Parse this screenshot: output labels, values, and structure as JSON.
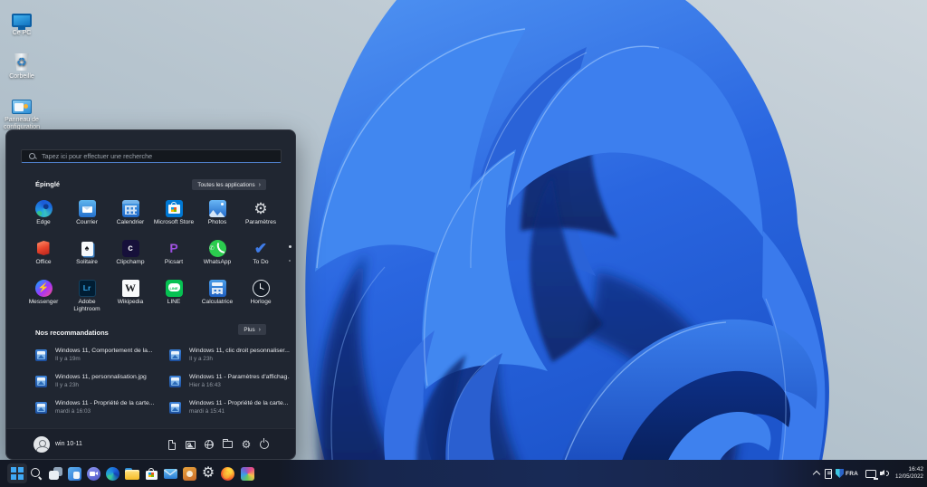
{
  "desktop": {
    "icons": [
      {
        "label": "Ce PC",
        "icon": "this-pc-icon"
      },
      {
        "label": "Corbeille",
        "icon": "recycle-bin-icon"
      },
      {
        "label": "Panneau de configuration",
        "icon": "control-panel-icon"
      }
    ]
  },
  "start_menu": {
    "search_placeholder": "Tapez ici pour effectuer une recherche",
    "pinned_header": "Épinglé",
    "all_apps_label": "Toutes les applications",
    "chevron": "›",
    "pinned_apps": [
      {
        "label": "Edge",
        "icon": "edge-icon"
      },
      {
        "label": "Courrier",
        "icon": "mail-icon"
      },
      {
        "label": "Calendrier",
        "icon": "calendar-icon"
      },
      {
        "label": "Microsoft Store",
        "icon": "store-icon"
      },
      {
        "label": "Photos",
        "icon": "photos-icon"
      },
      {
        "label": "Paramètres",
        "icon": "settings-gear-icon"
      },
      {
        "label": "Office",
        "icon": "office-icon"
      },
      {
        "label": "Solitaire",
        "icon": "solitaire-icon"
      },
      {
        "label": "Clipchamp",
        "icon": "clipchamp-icon"
      },
      {
        "label": "Picsart",
        "icon": "picsart-icon"
      },
      {
        "label": "WhatsApp",
        "icon": "whatsapp-icon"
      },
      {
        "label": "To Do",
        "icon": "todo-check-icon"
      },
      {
        "label": "Messenger",
        "icon": "messenger-icon"
      },
      {
        "label": "Adobe Lightroom",
        "icon": "lightroom-icon"
      },
      {
        "label": "Wikipedia",
        "icon": "wikipedia-icon"
      },
      {
        "label": "LINE",
        "icon": "line-icon"
      },
      {
        "label": "Calculatrice",
        "icon": "calculator-icon"
      },
      {
        "label": "Horloge",
        "icon": "clock-icon"
      }
    ],
    "recommended_header": "Nos recommandations",
    "more_label": "Plus",
    "recommended": [
      {
        "title": "Windows 11, Comportement de la...",
        "time": "Il y a 19m",
        "icon": "image-file-icon"
      },
      {
        "title": "Windows 11, clic droit pesonnaliser....",
        "time": "Il y a 23h",
        "icon": "image-file-icon"
      },
      {
        "title": "Windows 11, personnalisation.jpg",
        "time": "Il y a 23h",
        "icon": "image-file-icon"
      },
      {
        "title": "Windows 11 - Paramètres d'affichag...",
        "time": "Hier à 16:43",
        "icon": "image-file-icon"
      },
      {
        "title": "Windows 11 - Propriété de la carte...",
        "time": "mardi à 16:03",
        "icon": "image-file-icon"
      },
      {
        "title": "Windows 11 - Propriété de la carte...",
        "time": "mardi à 15:41",
        "icon": "image-file-icon"
      }
    ],
    "user_name": "win 10-11",
    "user_avatar_icon": "person-icon",
    "quick_actions": [
      "document-icon",
      "pictures-icon",
      "globe-icon",
      "folder-icon",
      "gear-icon",
      "power-icon"
    ],
    "pinned_scroll_dots": 2
  },
  "taskbar": {
    "icons": [
      "windows-logo-icon",
      "search-icon",
      "task-view-icon",
      "widgets-icon",
      "teams-chat-icon",
      "edge-icon",
      "file-explorer-icon",
      "store-icon",
      "mail-icon",
      "media-app-icon",
      "settings-gear-icon",
      "firefox-icon",
      "photos-app-icon"
    ],
    "active_icon": "windows-logo-icon"
  },
  "tray": {
    "icons": [
      "chevron-up-icon",
      "pen-tablet-icon",
      "shield-icon",
      "network-icon",
      "volume-icon"
    ],
    "language": "FRA",
    "time": "16:42",
    "date": "12/05/2022"
  }
}
